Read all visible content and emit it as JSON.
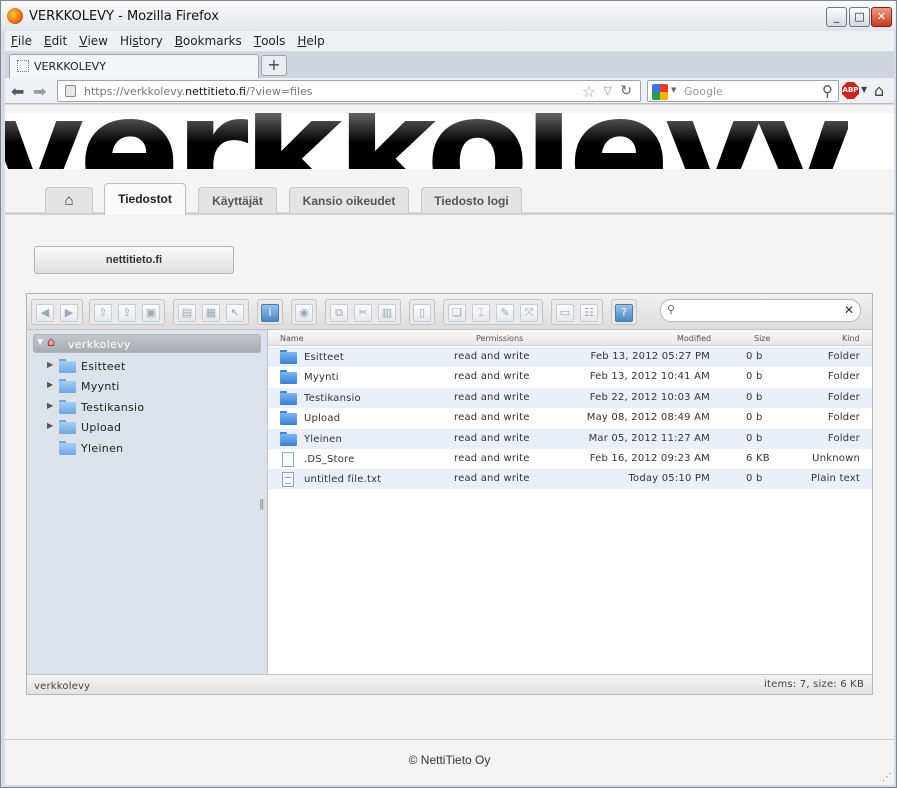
{
  "window": {
    "title": "VERKKOLEVY - Mozilla Firefox",
    "min": "_",
    "max": "□",
    "close": "✕"
  },
  "menu": [
    {
      "pre": "",
      "u": "F",
      "post": "ile"
    },
    {
      "pre": "",
      "u": "E",
      "post": "dit"
    },
    {
      "pre": "",
      "u": "V",
      "post": "iew"
    },
    {
      "pre": "Hi",
      "u": "s",
      "post": "tory"
    },
    {
      "pre": "",
      "u": "B",
      "post": "ookmarks"
    },
    {
      "pre": "",
      "u": "T",
      "post": "ools"
    },
    {
      "pre": "",
      "u": "H",
      "post": "elp"
    }
  ],
  "browser_tab": {
    "label": "VERKKOLEVY",
    "new_tab": "+"
  },
  "address": {
    "prefix": "https://verkkolevy.",
    "domain": "nettitieto.fi",
    "suffix": "/?view=files"
  },
  "search": {
    "placeholder": "Google",
    "engine_icon": "google-icon"
  },
  "addon": {
    "label": "ABP"
  },
  "banner": {
    "wordmark": "verkkolevy"
  },
  "app_tabs": {
    "home_icon": "⌂",
    "files": "Tiedostot",
    "users": "Käyttäjät",
    "perms": "Kansio oikeudet",
    "log": "Tiedosto logi"
  },
  "domain_button": "nettitieto.fi",
  "finder": {
    "search_placeholder": "",
    "tree": {
      "root": "verkkolevy",
      "items": [
        {
          "label": "Esitteet",
          "expandable": true
        },
        {
          "label": "Myynti",
          "expandable": true
        },
        {
          "label": "Testikansio",
          "expandable": true
        },
        {
          "label": "Upload",
          "expandable": true
        },
        {
          "label": "Yleinen",
          "expandable": false
        }
      ]
    },
    "columns": {
      "name": "Name",
      "perms": "Permissions",
      "modified": "Modified",
      "size": "Size",
      "kind": "Kind"
    },
    "files": [
      {
        "name": "Esitteet",
        "perms": "read and write",
        "modified": "Feb 13, 2012 05:27 PM",
        "size": "0 b",
        "kind": "Folder",
        "type": "folder"
      },
      {
        "name": "Myynti",
        "perms": "read and write",
        "modified": "Feb 13, 2012 10:41 AM",
        "size": "0 b",
        "kind": "Folder",
        "type": "folder"
      },
      {
        "name": "Testikansio",
        "perms": "read and write",
        "modified": "Feb 22, 2012 10:03 AM",
        "size": "0 b",
        "kind": "Folder",
        "type": "folder"
      },
      {
        "name": "Upload",
        "perms": "read and write",
        "modified": "May 08, 2012 08:49 AM",
        "size": "0 b",
        "kind": "Folder",
        "type": "folder"
      },
      {
        "name": "Yleinen",
        "perms": "read and write",
        "modified": "Mar 05, 2012 11:27 AM",
        "size": "0 b",
        "kind": "Folder",
        "type": "folder"
      },
      {
        "name": ".DS_Store",
        "perms": "read and write",
        "modified": "Feb 16, 2012 09:23 AM",
        "size": "6 KB",
        "kind": "Unknown",
        "type": "file"
      },
      {
        "name": "untitled file.txt",
        "perms": "read and write",
        "modified": "Today 05:10 PM",
        "size": "0 b",
        "kind": "Plain text",
        "type": "text"
      }
    ],
    "status": {
      "cwd": "verkkolevy",
      "count": "items: 7, size: 6 KB"
    }
  },
  "footer": "© NettiTieto Oy"
}
